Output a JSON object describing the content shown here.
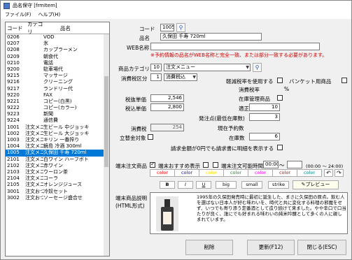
{
  "window": {
    "title": "品名保守 [frmItem]"
  },
  "menu": [
    "ファイル(F)",
    "ヘルプ(H)"
  ],
  "list": {
    "headers": [
      "コード",
      "カテゴリ",
      "品名"
    ],
    "rows": [
      [
        "0206",
        "",
        "VOD"
      ],
      [
        "0207",
        "",
        "氷"
      ],
      [
        "0208",
        "",
        "カップラーメン"
      ],
      [
        "0209",
        "",
        "朝食代"
      ],
      [
        "0210",
        "",
        "電話"
      ],
      [
        "9200",
        "",
        "駐車場代"
      ],
      [
        "9215",
        "",
        "マッサージ"
      ],
      [
        "9216",
        "",
        "クリーニング"
      ],
      [
        "9217",
        "",
        "ランドリー代"
      ],
      [
        "9220",
        "",
        "FAX"
      ],
      [
        "9221",
        "",
        "コピー(白黒)"
      ],
      [
        "9222",
        "",
        "コピー(カラー)"
      ],
      [
        "9223",
        "",
        "新聞"
      ],
      [
        "9224",
        "",
        "通信費"
      ],
      [
        "1001",
        "注文メニ…",
        "生ビール 中ジョッキ"
      ],
      [
        "1002",
        "注文メニ…",
        "生ビール 大ジョッキ"
      ],
      [
        "1003",
        "注文メニ…",
        "キリン 一番搾り"
      ],
      [
        "1004",
        "注文メニ…",
        "鏡島 冷酒 300ml"
      ],
      [
        "1005",
        "注文メニ…",
        "久保田 千寿 720ml"
      ],
      [
        "2101",
        "注文メニ…",
        "白ワイン ハーフボト"
      ],
      [
        "2102",
        "注文メニ…",
        "赤ワイン"
      ],
      [
        "2103",
        "注文メニ…",
        "ウーロン茶"
      ],
      [
        "2104",
        "注文メニ…",
        "コーラ"
      ],
      [
        "2105",
        "注文メニ…",
        "オレンジジュース"
      ],
      [
        "3001",
        "注文おつ…",
        "冷奴セット"
      ],
      [
        "3002",
        "注文おつ…",
        "ソーセージ盛合せ"
      ]
    ],
    "selected_index": 18
  },
  "form": {
    "code_label": "コード",
    "code_value": "1005",
    "name_label": "品名",
    "name_value": "久保田 千寿 720ml",
    "web_name_label": "WEB名称",
    "web_name_value": "",
    "web_warning": "※予約情報の品名がWEB名称と完全一致、または部分一致する必要があります。",
    "category_label": "商品カテゴリ",
    "category_code": "10",
    "category_name": "注文メニュー",
    "tax_kind_label": "消費税区分",
    "tax_kind_code": "1",
    "tax_kind_name": "消費税込",
    "reduced_tax_label": "軽減税率を使用する",
    "banquet_label": "バンケット用商品",
    "tax_rate_label": "消費税率",
    "tax_rate_unit": "%",
    "price_ex_label": "税抜単価",
    "price_ex_value": "2,546",
    "price_in_label": "税込単価",
    "price_in_value": "2,800",
    "tax_label": "消費税",
    "tax_value": "254",
    "exempt_label": "立替金対象",
    "stock_manage_label": "在庫管理商品",
    "stock_proper_label": "適正在庫数",
    "stock_proper_value": "10",
    "order_point_label": "発注点(最低在庫数)",
    "order_point_value": "3",
    "reserved_label": "現在予約数",
    "reserved_value": "",
    "stock_label": "在庫数",
    "stock_value": "6",
    "zero_yen_label": "請求金額が0円でも請求書に明細を表示する"
  },
  "terminal": {
    "order_item_label": "端末注文商品",
    "recommend_label": "端末おすすめ表示",
    "time_label": "端末注文可能時間",
    "time_from": "00:00",
    "time_to": "",
    "time_hint": "(00:00 ～ 24:00)",
    "color_labels": [
      "color",
      "color",
      "color",
      "color",
      "color",
      "color",
      "color"
    ],
    "color_values": [
      "#ff0000",
      "#0000ff",
      "#ffd700",
      "#00a000",
      "#ff00ff",
      "#e00000",
      "#008080"
    ],
    "format_labels": [
      "B",
      "I",
      "U",
      "big",
      "small",
      "strike"
    ],
    "preview_label": "プレビュー",
    "desc_label": "端末商品説明",
    "desc_label2": "(HTML形式)",
    "desc_text": "1995年の久保田発売時に最初に誕生した、まさに久保田の原点。飲む人を選ばない日本人が好む味わいを、時代と共に変化する料理の邪魔をせず、いつでも寄り添う定番酒として造り続けて来ました。やや辛口で口当たりが良く、誰にでも好まれる味わいの純米吟醸として多くの人に親しまれています。"
  },
  "buttons": {
    "delete": "削除",
    "update": "更新(F12)",
    "close": "閉じる(ESC)"
  }
}
